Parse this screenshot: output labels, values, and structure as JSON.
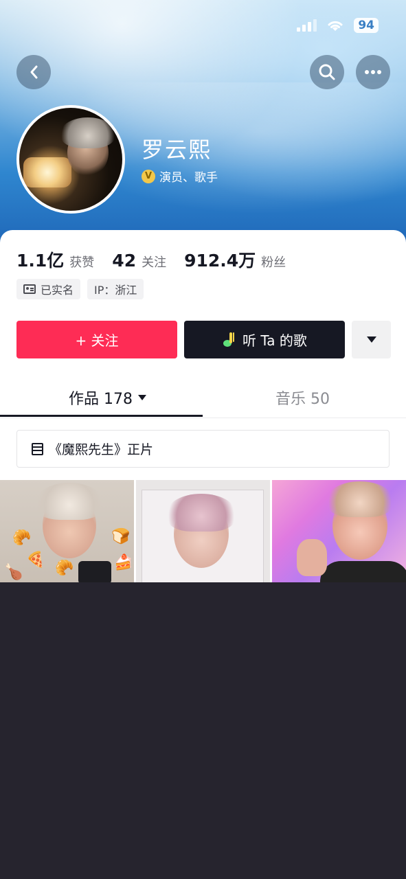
{
  "status_bar": {
    "battery": "94"
  },
  "profile": {
    "name": "罗云熙",
    "verification": "演员、歌手",
    "verified_badge": "V"
  },
  "stats": [
    {
      "value": "1.1亿",
      "label": "获赞"
    },
    {
      "value": "42",
      "label": "关注"
    },
    {
      "value": "912.4万",
      "label": "粉丝"
    }
  ],
  "tags": [
    {
      "label": "已实名",
      "icon": "id-card-icon"
    },
    {
      "label": "IP：浙江"
    }
  ],
  "actions": {
    "follow": "+ 关注",
    "listen": "听 Ta 的歌"
  },
  "tabs": [
    {
      "label": "作品 178",
      "selected": true
    },
    {
      "label": "音乐 50",
      "selected": false
    }
  ],
  "collection": {
    "label": "《魔熙先生》正片"
  },
  "colors": {
    "accent": "#fe2c55",
    "dark": "#161823"
  }
}
